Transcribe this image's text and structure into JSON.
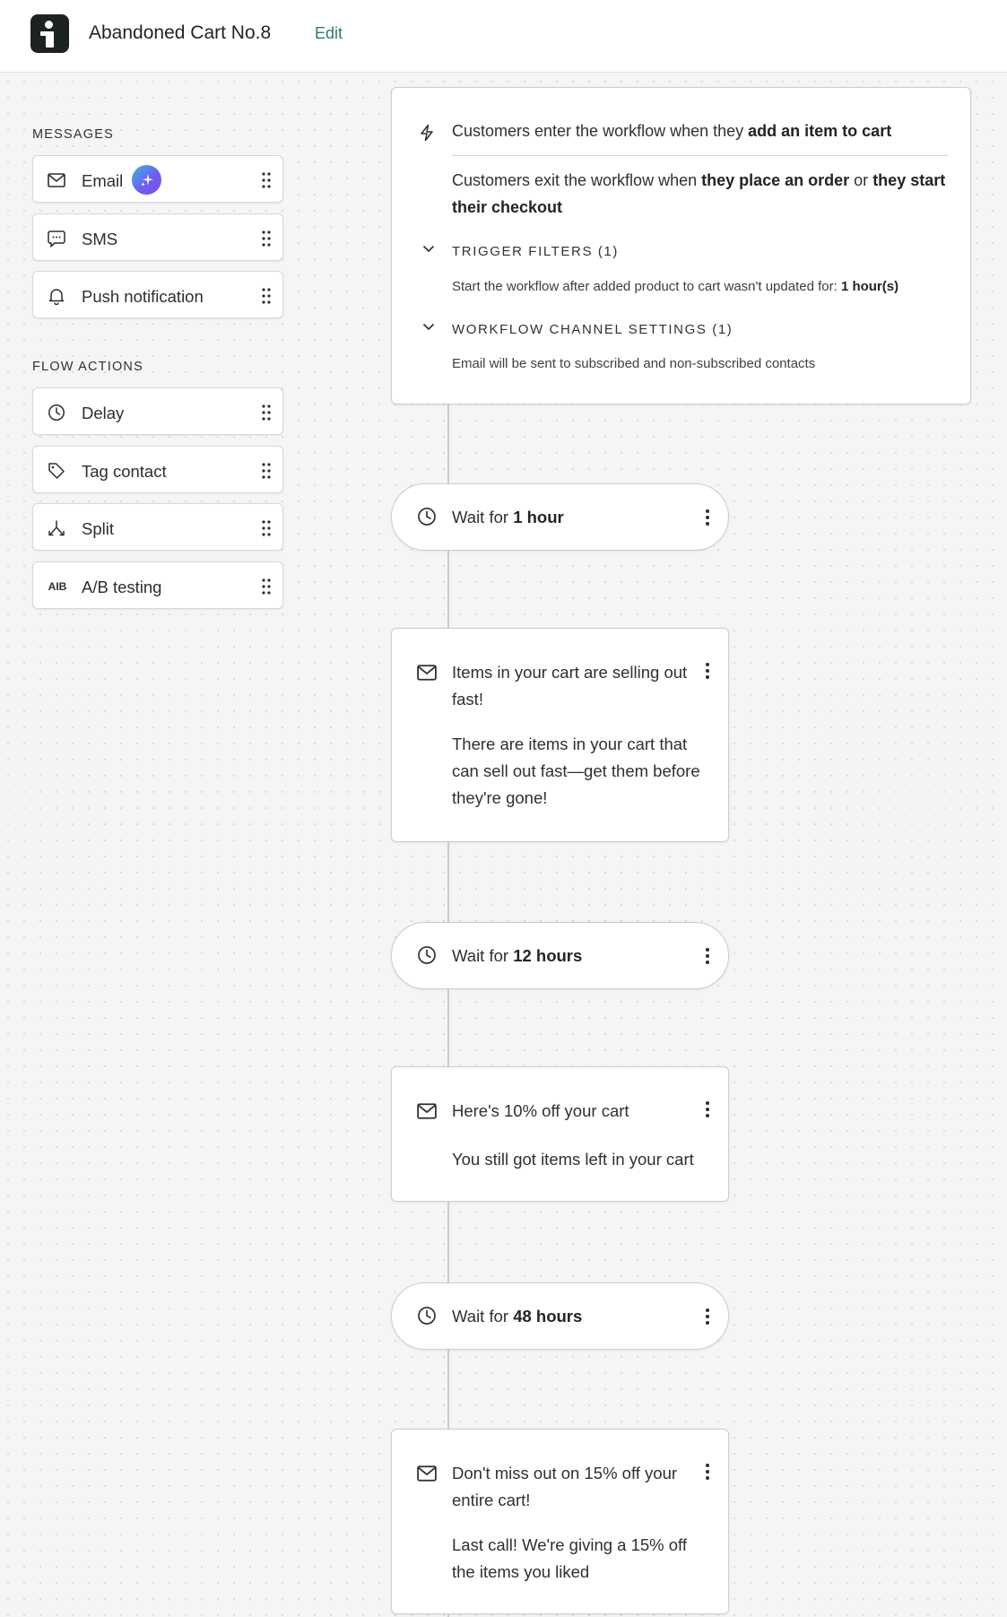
{
  "header": {
    "title": "Abandoned Cart No.8",
    "edit_label": "Edit"
  },
  "sidebar": {
    "messages_heading": "MESSAGES",
    "messages": [
      {
        "label": "Email",
        "icon": "mail-icon",
        "ai_badge": true
      },
      {
        "label": "SMS",
        "icon": "chat-bubble-icon"
      },
      {
        "label": "Push notification",
        "icon": "bell-icon"
      }
    ],
    "actions_heading": "FLOW ACTIONS",
    "actions": [
      {
        "label": "Delay",
        "icon": "clock-icon"
      },
      {
        "label": "Tag contact",
        "icon": "tag-icon"
      },
      {
        "label": "Split",
        "icon": "split-icon"
      },
      {
        "label": "A/B testing",
        "icon": "ab-test-icon",
        "icon_text": "AIB"
      }
    ]
  },
  "trigger": {
    "enter_prefix": "Customers enter the workflow when they ",
    "enter_bold": "add an item to cart",
    "exit_prefix": "Customers exit the workflow when ",
    "exit_bold_1": "they place an order",
    "exit_mid": " or ",
    "exit_bold_2": "they start their checkout",
    "filters_heading": "TRIGGER FILTERS (1)",
    "filters_desc_prefix": "Start the workflow after added product to cart wasn't updated for: ",
    "filters_desc_bold": "1 hour(s)",
    "channel_heading": "WORKFLOW CHANNEL SETTINGS (1)",
    "channel_desc": "Email will be sent to subscribed and non-subscribed contacts"
  },
  "steps": [
    {
      "type": "wait",
      "prefix": "Wait for ",
      "value": "1 hour"
    },
    {
      "type": "email",
      "subject": "Items in your cart are selling out fast!",
      "preview": "There are items in your cart that can sell out fast—get them before they're gone!"
    },
    {
      "type": "wait",
      "prefix": "Wait for ",
      "value": "12 hours"
    },
    {
      "type": "email",
      "subject": "Here's 10% off your cart",
      "preview": "You still got items left in your cart"
    },
    {
      "type": "wait",
      "prefix": "Wait for ",
      "value": "48 hours"
    },
    {
      "type": "email",
      "subject": "Don't miss out on 15% off your entire cart!",
      "preview": "Last call! We're giving a 15% off the items you liked"
    }
  ],
  "colors": {
    "accent": "#2b7a72",
    "logo_bg": "#1d2323",
    "canvas_bg": "#f4f5f4"
  }
}
